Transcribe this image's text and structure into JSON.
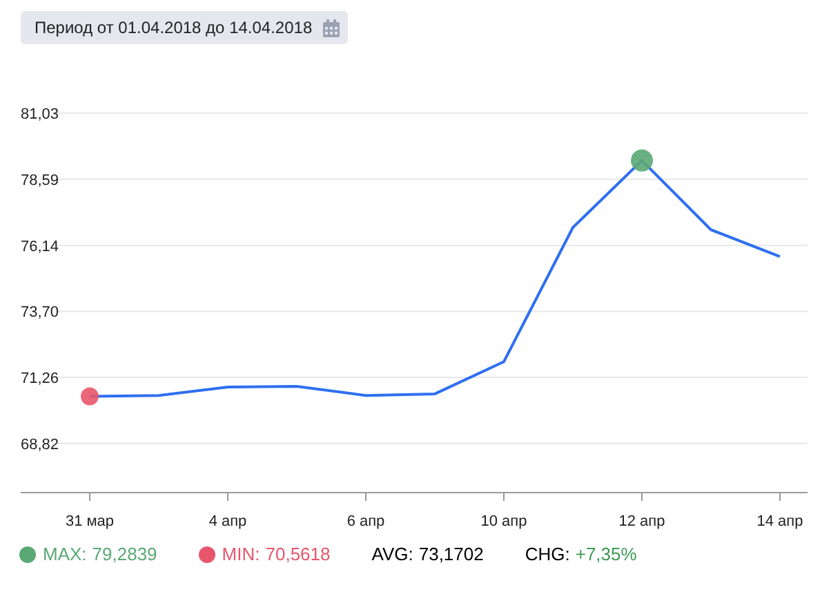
{
  "period_button": {
    "label": "Период от 01.04.2018 до 14.04.2018"
  },
  "chart": {
    "chart_data": {
      "type": "line",
      "categories": [
        "31 мар",
        null,
        "4 апр",
        null,
        "6 апр",
        null,
        "10 апр",
        null,
        "12 апр",
        null,
        "14 апр"
      ],
      "ylim": [
        67.0,
        81.03
      ],
      "grid": true,
      "yticks": [
        {
          "value": 68.82,
          "label": "68,82"
        },
        {
          "value": 71.26,
          "label": "71,26"
        },
        {
          "value": 73.7,
          "label": "73,70"
        },
        {
          "value": 76.14,
          "label": "76,14"
        },
        {
          "value": 78.59,
          "label": "78,59"
        },
        {
          "value": 81.03,
          "label": "81,03"
        }
      ],
      "series": [
        {
          "color": "#2f6ff0",
          "values": [
            70.56,
            70.59,
            70.9,
            70.93,
            70.59,
            70.65,
            71.84,
            76.8,
            79.28,
            76.72,
            75.73
          ]
        }
      ]
    },
    "markers": [
      {
        "kind": "max",
        "color": "#5aa874"
      },
      {
        "kind": "min",
        "color": "#e8566c"
      }
    ]
  },
  "stats": [
    {
      "kind": "dot",
      "label": "MAX:",
      "value": "79,2839",
      "color": "#5aa874"
    },
    {
      "kind": "dot",
      "label": "MIN:",
      "value": "70,5618",
      "color": "#e8566c"
    },
    {
      "kind": "plain",
      "label": "AVG:",
      "value": "73,1702"
    },
    {
      "kind": "signed",
      "label": "CHG:",
      "value": "+7,35%"
    }
  ]
}
